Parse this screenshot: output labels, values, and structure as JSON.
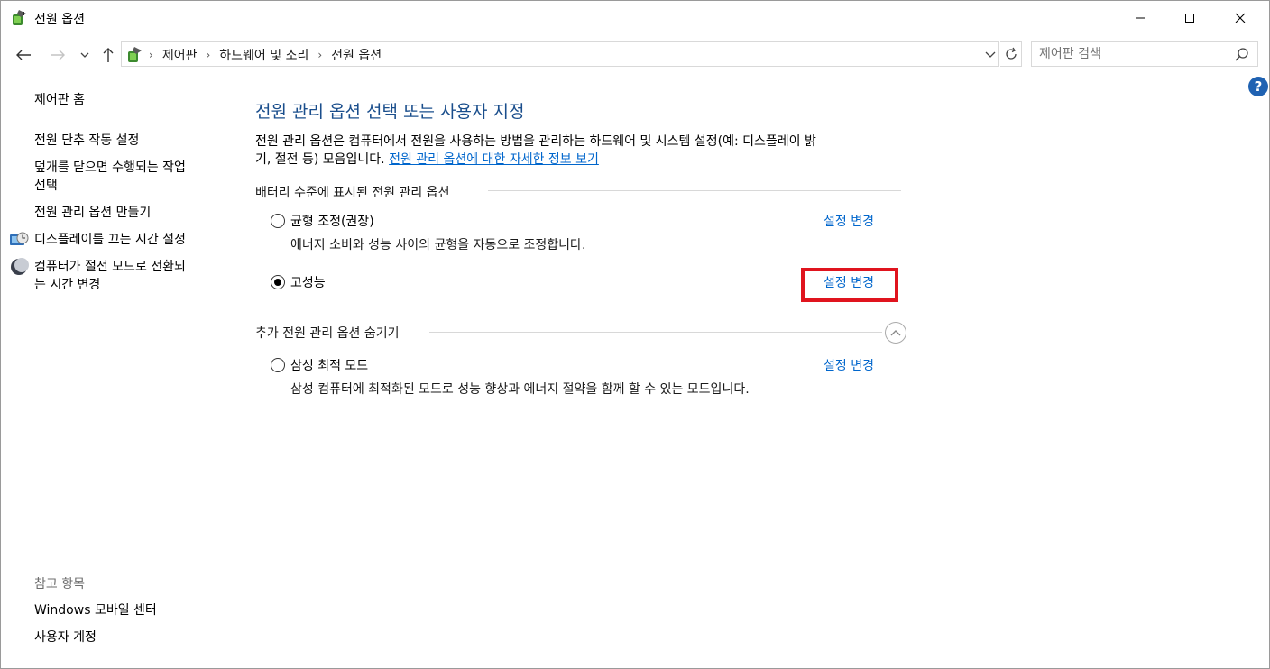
{
  "window": {
    "title": "전원 옵션"
  },
  "nav": {
    "breadcrumbs": [
      "제어판",
      "하드웨어 및 소리",
      "전원 옵션"
    ],
    "search_placeholder": "제어판 검색",
    "help_label": "?"
  },
  "sidebar": {
    "home": "제어판 홈",
    "items": [
      {
        "label": "전원 단추 작동 설정"
      },
      {
        "label_line1": "덮개를 닫으면 수행되는 작업",
        "label_line2": "선택"
      },
      {
        "label": "전원 관리 옵션 만들기"
      },
      {
        "label": "디스플레이를 끄는 시간 설정",
        "icon": "display-timer-icon"
      },
      {
        "label_line1": "컴퓨터가 절전 모드로 전환되",
        "label_line2": "는 시간 변경",
        "icon": "sleep-moon-icon"
      }
    ],
    "see_also_title": "참고 항목",
    "see_also": [
      "Windows 모바일 센터",
      "사용자 계정"
    ]
  },
  "main": {
    "title": "전원 관리 옵션 선택 또는 사용자 지정",
    "desc_line1": "전원 관리 옵션은 컴퓨터에서 전원을 사용하는 방법을 관리하는 하드웨어 및 시스템 설정(예: 디스플레이 밝",
    "desc_line2": "기, 절전 등) 모음입니다.",
    "desc_link": "전원 관리 옵션에 대한 자세한 정보 보기",
    "battery_section": "배터리 수준에 표시된 전원 관리 옵션",
    "extra_section": "추가 전원 관리 옵션 숨기기",
    "change_label": "설정 변경",
    "plans": [
      {
        "name": "균형 조정(권장)",
        "desc": "에너지 소비와 성능 사이의 균형을 자동으로 조정합니다.",
        "selected": false
      },
      {
        "name": "고성능",
        "desc": "",
        "selected": true
      },
      {
        "name": "삼성 최적 모드",
        "desc": "삼성 컴퓨터에 최적화된 모드로 성능 향상과 에너지 절약을 함께 할 수 있는 모드입니다.",
        "selected": false
      }
    ]
  },
  "colors": {
    "title_blue": "#1a4e8c",
    "link_blue": "#0066cc",
    "highlight_red": "#e0141e"
  }
}
